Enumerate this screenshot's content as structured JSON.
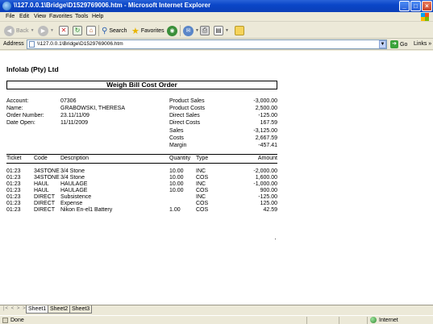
{
  "window": {
    "title": "\\\\127.0.0.1\\Bridge\\D1529769006.htm - Microsoft Internet Explorer",
    "min_glyph": "_",
    "max_glyph": "□",
    "close_glyph": "×"
  },
  "menu": {
    "items": [
      "File",
      "Edit",
      "View",
      "Favorites",
      "Tools",
      "Help"
    ]
  },
  "toolbar": {
    "back_label": "Back",
    "search_label": "Search",
    "favorites_label": "Favorites"
  },
  "address": {
    "label": "Address",
    "value": "\\\\127.0.0.1\\Bridge\\D1529769006.htm",
    "go_label": "Go",
    "links_label": "Links"
  },
  "report": {
    "company": "Infolab (Pty) Ltd",
    "title": "Weigh Bill Cost Order",
    "info": {
      "account_label": "Account:",
      "account_value": "07306",
      "name_label": "Name:",
      "name_value": "GRABOWSKI, THERESA",
      "order_label": "Order Number:",
      "order_value": "23.11/11/09",
      "date_label": "Date Open:",
      "date_value": "11/11/2009"
    },
    "summary": [
      {
        "label": "Product Sales",
        "value": "-3,000.00"
      },
      {
        "label": "Product Costs",
        "value": "2,500.00"
      },
      {
        "label": "Direct Sales",
        "value": "-125.00"
      },
      {
        "label": "Direct Costs",
        "value": "167.59"
      },
      {
        "label": "Sales",
        "value": "-3,125.00"
      },
      {
        "label": "Costs",
        "value": "2,667.59"
      },
      {
        "label": "Margin",
        "value": "-457.41"
      }
    ],
    "columns": [
      "Ticket",
      "Code",
      "Description",
      "Quantity",
      "Type",
      "Amount"
    ],
    "rows": [
      [
        "01:23",
        "34STONE",
        "3/4 Stone",
        "10.00",
        "INC",
        "-2,000.00"
      ],
      [
        "01:23",
        "34STONE",
        "3/4 Stone",
        "10.00",
        "COS",
        "1,600.00"
      ],
      [
        "01:23",
        "HAUL",
        "HAULAGE",
        "10.00",
        "INC",
        "-1,000.00"
      ],
      [
        "01:23",
        "HAUL",
        "HAULAGE",
        "10.00",
        "COS",
        "900.00"
      ],
      [
        "01:23",
        "DIRECT",
        "Subsistence",
        "",
        "INC",
        "-125.00"
      ],
      [
        "01:23",
        "DIRECT",
        "Expense",
        "",
        "COS",
        "125.00"
      ],
      [
        "01:23",
        "DIRECT",
        "Nikon En-el1 Battery",
        "1.00",
        "COS",
        "42.59"
      ]
    ]
  },
  "sheets": {
    "nav": "|< < > >|",
    "tabs": [
      "Sheet1",
      "Sheet2",
      "Sheet3"
    ],
    "active": "Sheet1"
  },
  "status": {
    "left": "Done",
    "zone": "Internet"
  }
}
